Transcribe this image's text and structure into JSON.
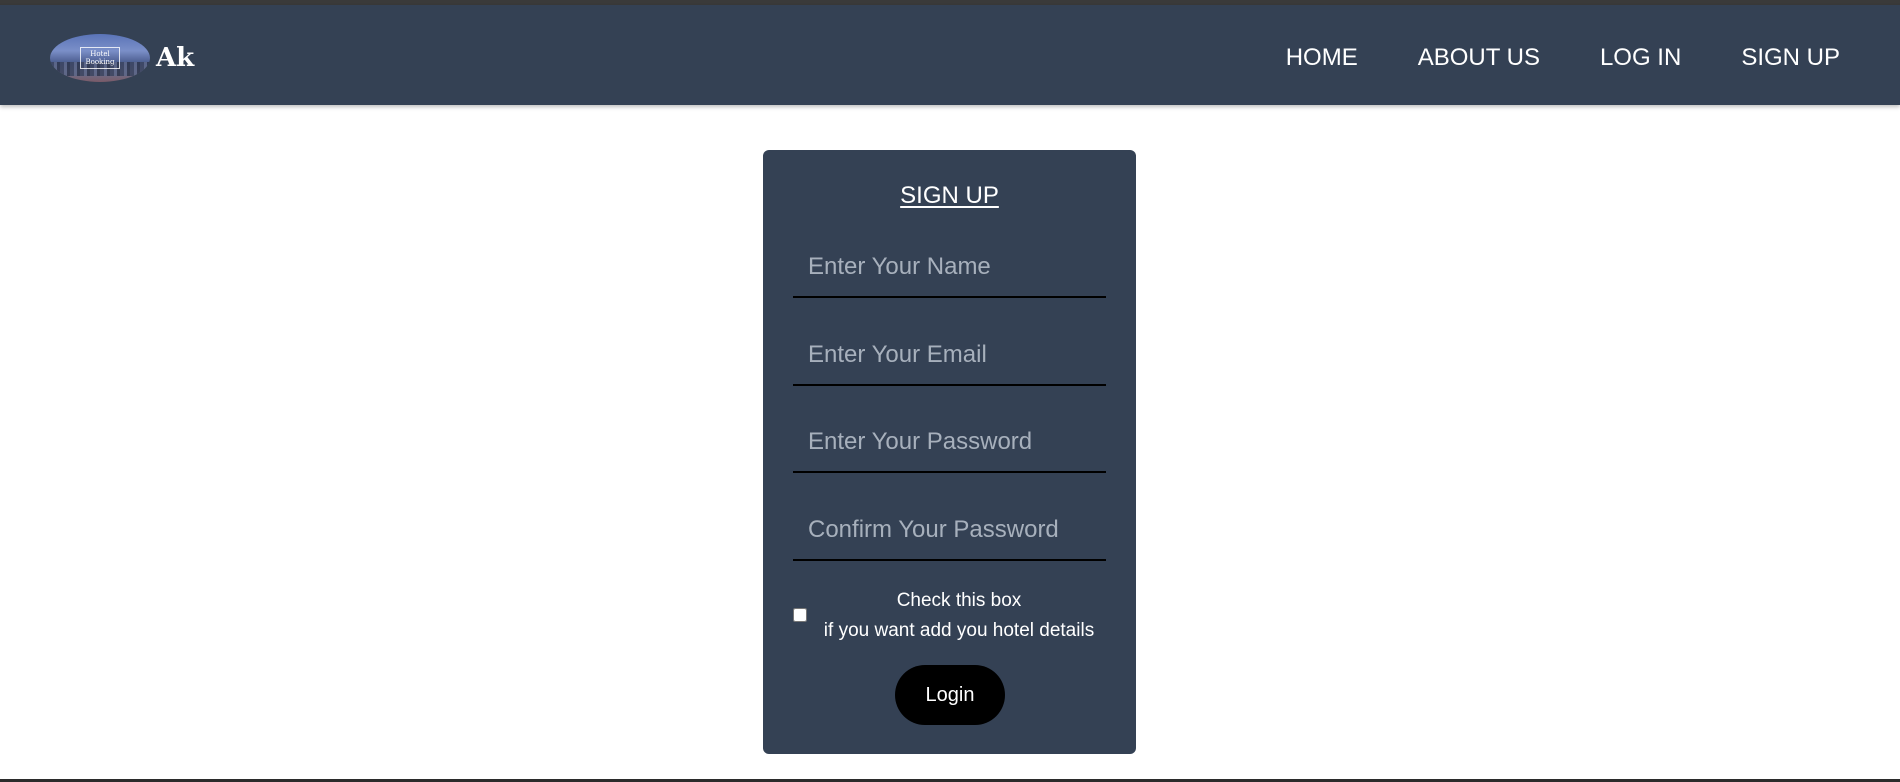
{
  "navbar": {
    "brand": "Ak",
    "logo_text": [
      "Hotel",
      "Booking"
    ],
    "links": [
      "HOME",
      "ABOUT US",
      "LOG IN",
      "SIGN UP"
    ]
  },
  "form": {
    "title": "SIGN UP",
    "fields": [
      {
        "placeholder": "Enter Your Name",
        "value": ""
      },
      {
        "placeholder": "Enter Your Email",
        "value": ""
      },
      {
        "placeholder": "Enter Your Password",
        "value": ""
      },
      {
        "placeholder": "Confirm Your Password",
        "value": ""
      }
    ],
    "checkbox": {
      "checked": false,
      "line1": "Check this box",
      "line2": "if you want add you hotel details"
    },
    "submit_label": "Login"
  },
  "colors": {
    "navbar_bg": "#344154",
    "card_bg": "#344154",
    "button_bg": "#000000",
    "text": "#ffffff"
  }
}
